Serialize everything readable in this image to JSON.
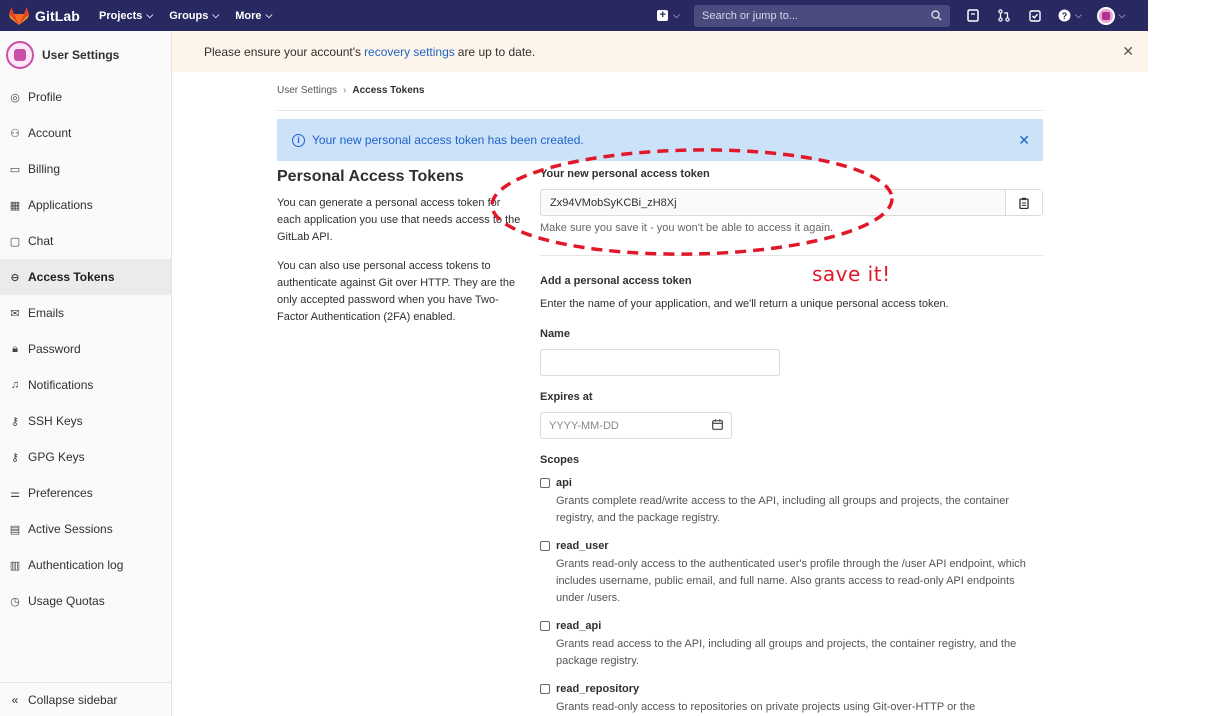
{
  "nav": {
    "brand": "GitLab",
    "links": [
      {
        "label": "Projects"
      },
      {
        "label": "Groups"
      },
      {
        "label": "More"
      }
    ],
    "search_placeholder": "Search or jump to...",
    "brand_color": "#292961"
  },
  "broadcast": {
    "text_before": "Please ensure your account's",
    "link": "recovery settings",
    "text_after": "are up to date."
  },
  "sidebar": {
    "title": "User Settings",
    "items": [
      {
        "label": "Profile",
        "icon": "profile-icon"
      },
      {
        "label": "Account",
        "icon": "account-icon"
      },
      {
        "label": "Billing",
        "icon": "billing-icon"
      },
      {
        "label": "Applications",
        "icon": "applications-icon"
      },
      {
        "label": "Chat",
        "icon": "chat-icon"
      },
      {
        "label": "Access Tokens",
        "icon": "token-icon",
        "active": true
      },
      {
        "label": "Emails",
        "icon": "email-icon"
      },
      {
        "label": "Password",
        "icon": "lock-icon"
      },
      {
        "label": "Notifications",
        "icon": "bell-icon"
      },
      {
        "label": "SSH Keys",
        "icon": "key-icon"
      },
      {
        "label": "GPG Keys",
        "icon": "key-icon"
      },
      {
        "label": "Preferences",
        "icon": "preferences-icon"
      },
      {
        "label": "Active Sessions",
        "icon": "monitor-icon"
      },
      {
        "label": "Authentication log",
        "icon": "log-icon"
      },
      {
        "label": "Usage Quotas",
        "icon": "quota-icon"
      }
    ],
    "collapse": "Collapse sidebar"
  },
  "breadcrumb": {
    "parent": "User Settings",
    "current": "Access Tokens"
  },
  "alert": {
    "message": "Your new personal access token has been created."
  },
  "intro": {
    "title": "Personal Access Tokens",
    "p1": "You can generate a personal access token for each application you use that needs access to the GitLab API.",
    "p2": "You can also use personal access tokens to authenticate against Git over HTTP. They are the only accepted password when you have Two-Factor Authentication (2FA) enabled."
  },
  "new_token": {
    "label": "Your new personal access token",
    "value": "Zx94VMobSyKCBi_zH8Xj",
    "help": "Make sure you save it - you won't be able to access it again."
  },
  "form": {
    "heading": "Add a personal access token",
    "description": "Enter the name of your application, and we'll return a unique personal access token.",
    "name_label": "Name",
    "name_value": "",
    "expires_label": "Expires at",
    "expires_placeholder": "YYYY-MM-DD",
    "scopes_label": "Scopes",
    "scopes": [
      {
        "name": "api",
        "checked": false,
        "desc": "Grants complete read/write access to the API, including all groups and projects, the container registry, and the package registry."
      },
      {
        "name": "read_user",
        "checked": false,
        "desc": "Grants read-only access to the authenticated user's profile through the /user API endpoint, which includes username, public email, and full name. Also grants access to read-only API endpoints under /users."
      },
      {
        "name": "read_api",
        "checked": false,
        "desc": "Grants read access to the API, including all groups and projects, the container registry, and the package registry."
      },
      {
        "name": "read_repository",
        "checked": false,
        "desc": "Grants read-only access to repositories on private projects using Git-over-HTTP or the"
      }
    ]
  },
  "annotation": {
    "text": "save it!",
    "color": "#e0182a"
  }
}
